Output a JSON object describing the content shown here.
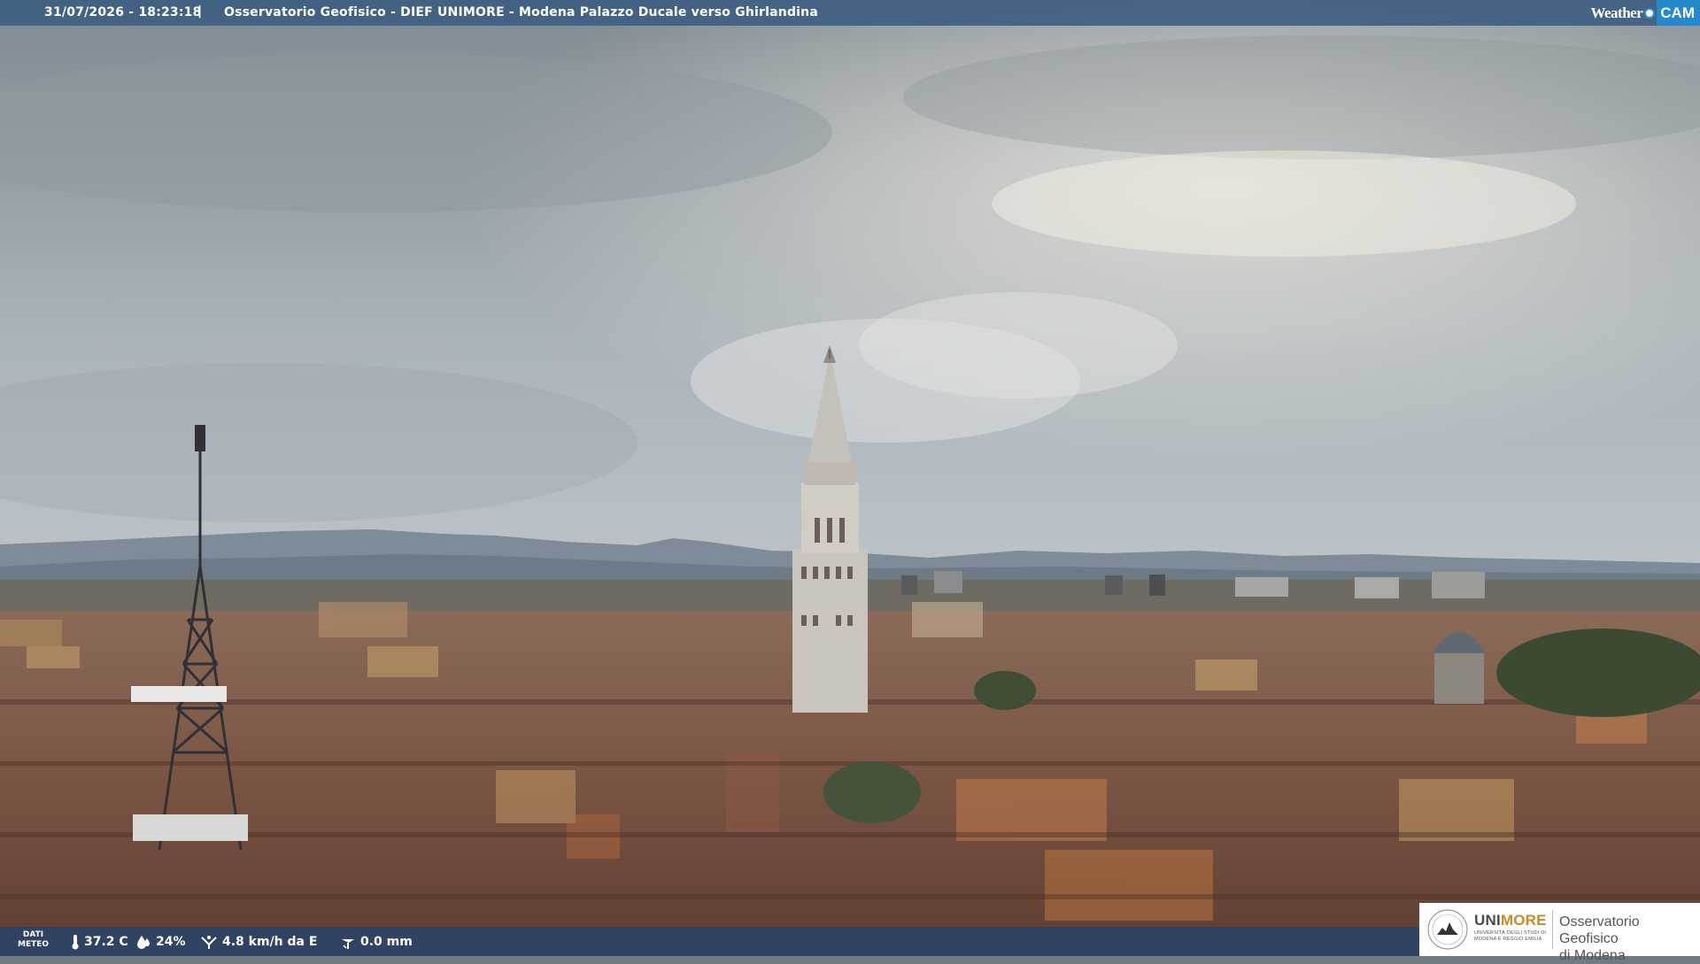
{
  "overlay": {
    "timestamp": "31/07/2026 - 18:23:18",
    "separator": "|",
    "location": "Osservatorio Geofisico - DIEF UNIMORE - Modena Palazzo Ducale verso Ghirlandina",
    "brand_weather": "Weather",
    "brand_cam": "CAM"
  },
  "weather": {
    "label_line1": "DATI",
    "label_line2": "METEO",
    "temperature": "37.2 C",
    "humidity": "24%",
    "wind": "4.8 km/h da E",
    "rain": "0.0 mm",
    "icons": [
      "thermometer-icon",
      "humidity-drop-icon",
      "wind-icon",
      "rain-gauge-icon"
    ]
  },
  "logo": {
    "uni_part1": "UNI",
    "uni_part2": "MORE",
    "uni_sub_line1": "UNIVERSITÀ DEGLI STUDI DI",
    "uni_sub_line2": "MODENA E REGGIO EMILIA",
    "observatory_line1": "Osservatorio Geofisico",
    "observatory_line2": "di Modena",
    "accent": "#c98a2a"
  },
  "colors": {
    "bar_top": "#3a5c82",
    "bar_bottom": "#26446c",
    "brand_blue": "#2489cc"
  }
}
